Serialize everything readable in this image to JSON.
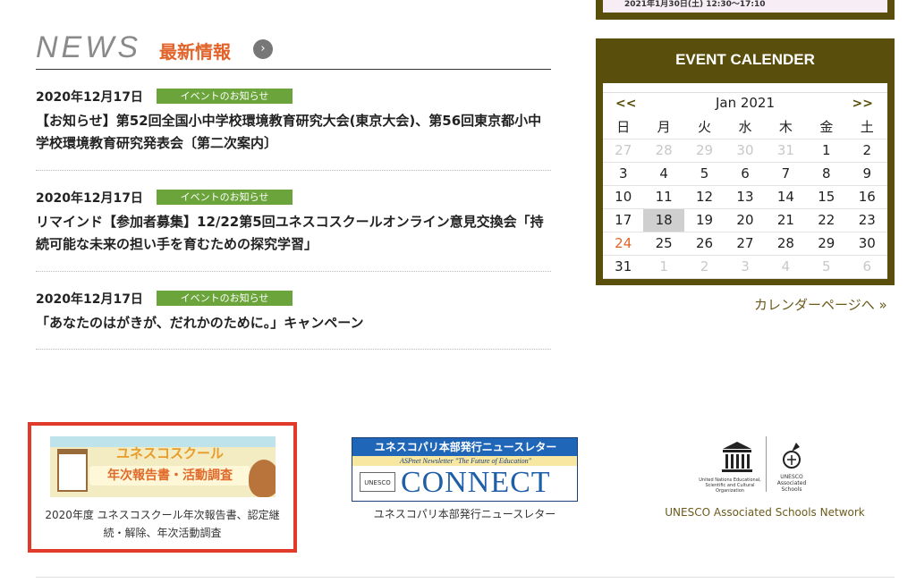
{
  "news": {
    "heading_en": "NEWS",
    "heading_ja": "最新情報",
    "more_glyph": "›",
    "items": [
      {
        "date": "2020年12月17日",
        "badge": "イベントのお知らせ",
        "title": "【お知らせ】第52回全国小中学校環境教育研究大会(東京大会)、第56回東京都小中学校環境教育研究発表会〔第二次案内〕"
      },
      {
        "date": "2020年12月17日",
        "badge": "イベントのお知らせ",
        "title": "リマインド【参加者募集】12/22第5回ユネスコスクールオンライン意見交換会「持続可能な未来の担い手を育むための探究学習」"
      },
      {
        "date": "2020年12月17日",
        "badge": "イベントのお知らせ",
        "title": "「あなたのはがきが、だれかのために。」キャンペーン"
      }
    ],
    "badge_color": "#6aa43a"
  },
  "top_banner": {
    "text": "2021年1月30日(土) 12:30〜17:10"
  },
  "calendar": {
    "title": "EVENT CALENDER",
    "prev": "<<",
    "next": ">>",
    "month": "Jan 2021",
    "weekdays": [
      "日",
      "月",
      "火",
      "水",
      "木",
      "金",
      "土"
    ],
    "weeks": [
      [
        "27",
        "28",
        "29",
        "30",
        "31",
        "1",
        "2"
      ],
      [
        "3",
        "4",
        "5",
        "6",
        "7",
        "8",
        "9"
      ],
      [
        "10",
        "11",
        "12",
        "13",
        "14",
        "15",
        "16"
      ],
      [
        "17",
        "18",
        "19",
        "20",
        "21",
        "22",
        "23"
      ],
      [
        "24",
        "25",
        "26",
        "27",
        "28",
        "29",
        "30"
      ],
      [
        "31",
        "1",
        "2",
        "3",
        "4",
        "5",
        "6"
      ]
    ],
    "today": "18",
    "highlight_day": "24",
    "link": "カレンダーページへ »",
    "frame_color": "#5a4e0c"
  },
  "banners": {
    "report": {
      "title_line1": "ユネスコスクール",
      "title_line2": "年次報告書・活動調査",
      "caption": "2020年度 ユネスコスクール年次報告書、認定継続・解除、年次活動調査"
    },
    "connect": {
      "top_text": "ユネスコパリ本部発行ニュースレター",
      "sub_text": "ASPnet Newsletter \"The Future of Education\"",
      "logo_text": "UNESCO",
      "big_text": "CONNECT",
      "caption": "ユネスコパリ本部発行ニュースレター"
    },
    "aspnet": {
      "logo_left_text": "United Nations Educational, Scientific and Cultural Organization",
      "logo_right_text": "UNESCO Associated Schools",
      "caption": "UNESCO Associated Schools Network"
    }
  }
}
